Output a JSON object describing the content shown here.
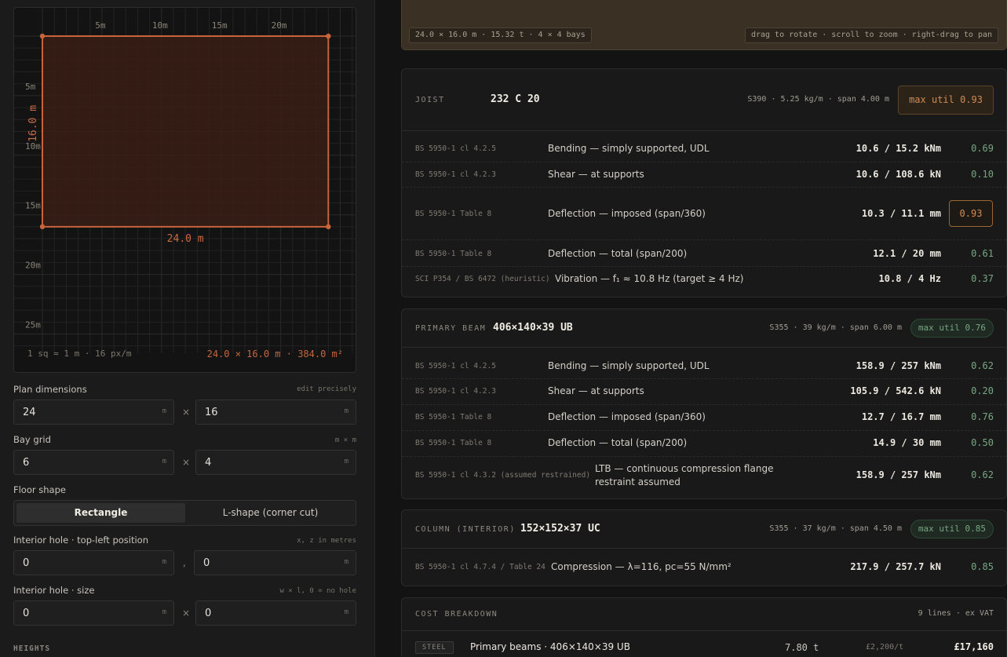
{
  "plan_view": {
    "x_ticks": [
      "5m",
      "10m",
      "15m",
      "20m"
    ],
    "y_ticks": [
      "5m",
      "10m",
      "15m",
      "20m",
      "25m"
    ],
    "width_label": "24.0 m",
    "depth_label": "16.0 m",
    "scale_note": "1 sq = 1 m · 16 px/m",
    "area_summary": "24.0 × 16.0 m · 384.0 m²",
    "colors": {
      "outline": "#c8633a",
      "fill": "#3a1f14",
      "grid": "#232323"
    }
  },
  "controls": {
    "plan_dimensions": {
      "label": "Plan dimensions",
      "hint": "edit precisely",
      "width": "24",
      "depth": "16",
      "unit": "m",
      "sep": "×"
    },
    "bay_grid": {
      "label": "Bay grid",
      "hint": "m × m",
      "x": "6",
      "y": "4",
      "unit": "m",
      "sep": "×"
    },
    "floor_shape": {
      "label": "Floor shape",
      "options": [
        "Rectangle",
        "L-shape (corner cut)"
      ],
      "selected": "Rectangle"
    },
    "hole_position": {
      "label": "Interior hole · top-left position",
      "hint": "x, z in metres",
      "x": "0",
      "z": "0",
      "unit": "m",
      "sep": ","
    },
    "hole_size": {
      "label": "Interior hole · size",
      "hint": "w × l, 0 = no hole",
      "w": "0",
      "l": "0",
      "unit": "m",
      "sep": "×"
    },
    "heights_heading": "HEIGHTS"
  },
  "viewport": {
    "summary": "24.0 × 16.0 m · 15.32 t · 4 × 4 bays",
    "hint": "drag to rotate · scroll to zoom · right-drag to pan"
  },
  "members": [
    {
      "role": "JOIST",
      "section": "232 C 20",
      "meta": "S390 · 5.25 kg/m · span 4.00 m",
      "max_util": "max util 0.93",
      "checks": [
        {
          "code": "BS 5950-1 cl 4.2.5",
          "desc": "Bending — simply supported, UDL",
          "value": "10.6 / 15.2 kNm",
          "util": "0.69"
        },
        {
          "code": "BS 5950-1 cl 4.2.3",
          "desc": "Shear — at supports",
          "value": "10.6 / 108.6 kN",
          "util": "0.10"
        },
        {
          "code": "BS 5950-1 Table 8",
          "desc": "Deflection — imposed (span/360)",
          "value": "10.3 / 11.1 mm",
          "util": "0.93"
        },
        {
          "code": "BS 5950-1 Table 8",
          "desc": "Deflection — total (span/200)",
          "value": "12.1 / 20 mm",
          "util": "0.61"
        },
        {
          "code": "SCI P354 / BS 6472 (heuristic)",
          "desc": "Vibration — f₁ ≈ 10.8 Hz (target ≥ 4 Hz)",
          "value": "10.8 / 4 Hz",
          "util": "0.37"
        }
      ]
    },
    {
      "role": "PRIMARY BEAM",
      "section": "406×140×39 UB",
      "meta": "S355 · 39 kg/m · span 6.00 m",
      "max_util": "max util 0.76",
      "checks": [
        {
          "code": "BS 5950-1 cl 4.2.5",
          "desc": "Bending — simply supported, UDL",
          "value": "158.9 / 257 kNm",
          "util": "0.62"
        },
        {
          "code": "BS 5950-1 cl 4.2.3",
          "desc": "Shear — at supports",
          "value": "105.9 / 542.6 kN",
          "util": "0.20"
        },
        {
          "code": "BS 5950-1 Table 8",
          "desc": "Deflection — imposed (span/360)",
          "value": "12.7 / 16.7 mm",
          "util": "0.76"
        },
        {
          "code": "BS 5950-1 Table 8",
          "desc": "Deflection — total (span/200)",
          "value": "14.9 / 30 mm",
          "util": "0.50"
        },
        {
          "code": "BS 5950-1 cl 4.3.2 (assumed restrained)",
          "desc": "LTB — continuous compression flange restraint assumed",
          "value": "158.9 / 257 kNm",
          "util": "0.62"
        }
      ]
    },
    {
      "role": "COLUMN (INTERIOR)",
      "section": "152×152×37 UC",
      "meta": "S355 · 37 kg/m · span 4.50 m",
      "max_util": "max util 0.85",
      "checks": [
        {
          "code": "BS 5950-1 cl 4.7.4 / Table 24",
          "desc": "Compression — λ=116, pc=55 N/mm²",
          "value": "217.9 / 257.7 kN",
          "util": "0.85"
        }
      ]
    }
  ],
  "cost": {
    "title": "COST BREAKDOWN",
    "meta": "9 lines · ex VAT",
    "lines": [
      {
        "tag": "STEEL",
        "item": "Primary beams · 406×140×39 UB",
        "qty": "7.80 t",
        "rate": "£2,200/t",
        "total": "£17,160"
      }
    ]
  }
}
